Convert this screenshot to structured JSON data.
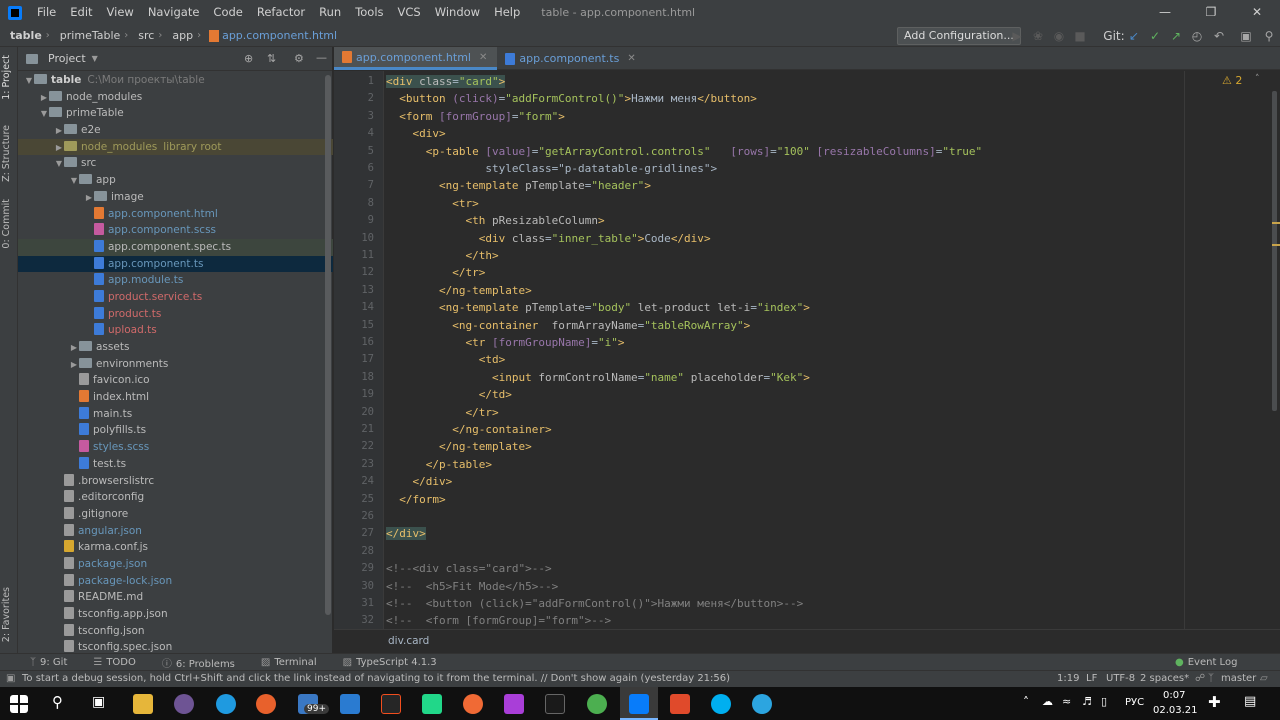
{
  "menu": {
    "items": [
      "File",
      "Edit",
      "View",
      "Navigate",
      "Code",
      "Refactor",
      "Run",
      "Tools",
      "VCS",
      "Window",
      "Help"
    ],
    "title": "table - app.component.html"
  },
  "nav": {
    "crumbs": [
      "table",
      "primeTable",
      "src",
      "app",
      "app.component.html"
    ],
    "add_config": "Add Configuration...",
    "git_label": "Git:"
  },
  "strip": {
    "project": "1: Project",
    "structure": "Z: Structure",
    "commit": "0: Commit",
    "favorites": "2: Favorites"
  },
  "project": {
    "title": "Project",
    "tree": [
      {
        "label": "table",
        "extra": "C:\\Мои проекты\\table",
        "depth": 0,
        "kind": "folder",
        "open": true,
        "color": "bold"
      },
      {
        "label": "node_modules",
        "depth": 1,
        "kind": "folder",
        "open": false,
        "color": "normal"
      },
      {
        "label": "primeTable",
        "depth": 1,
        "kind": "folder",
        "open": true,
        "color": "normal"
      },
      {
        "label": "e2e",
        "depth": 2,
        "kind": "folder",
        "open": false,
        "color": "normal"
      },
      {
        "label": "node_modules",
        "extra": "library root",
        "depth": 2,
        "kind": "folder",
        "open": false,
        "color": "olive",
        "row": "lib"
      },
      {
        "label": "src",
        "depth": 2,
        "kind": "folder",
        "open": true,
        "color": "normal"
      },
      {
        "label": "app",
        "depth": 3,
        "kind": "folder",
        "open": true,
        "color": "normal"
      },
      {
        "label": "image",
        "depth": 4,
        "kind": "folder",
        "open": false,
        "color": "normal"
      },
      {
        "label": "app.component.html",
        "depth": 4,
        "kind": "file",
        "color": "blue",
        "ico": "#e37933"
      },
      {
        "label": "app.component.scss",
        "depth": 4,
        "kind": "file",
        "color": "blue",
        "ico": "#c55a9f"
      },
      {
        "label": "app.component.spec.ts",
        "depth": 4,
        "kind": "file",
        "color": "normal",
        "ico": "#3d7bd8",
        "row": "hl"
      },
      {
        "label": "app.component.ts",
        "depth": 4,
        "kind": "file",
        "color": "blue",
        "ico": "#3d7bd8",
        "row": "sel"
      },
      {
        "label": "app.module.ts",
        "depth": 4,
        "kind": "file",
        "color": "blue",
        "ico": "#3d7bd8"
      },
      {
        "label": "product.service.ts",
        "depth": 4,
        "kind": "file",
        "color": "red",
        "ico": "#3d7bd8"
      },
      {
        "label": "product.ts",
        "depth": 4,
        "kind": "file",
        "color": "red",
        "ico": "#3d7bd8"
      },
      {
        "label": "upload.ts",
        "depth": 4,
        "kind": "file",
        "color": "red",
        "ico": "#3d7bd8"
      },
      {
        "label": "assets",
        "depth": 3,
        "kind": "folder",
        "open": false,
        "color": "normal"
      },
      {
        "label": "environments",
        "depth": 3,
        "kind": "folder",
        "open": false,
        "color": "normal"
      },
      {
        "label": "favicon.ico",
        "depth": 3,
        "kind": "file",
        "color": "normal",
        "ico": "#9a9a9a"
      },
      {
        "label": "index.html",
        "depth": 3,
        "kind": "file",
        "color": "normal",
        "ico": "#e37933"
      },
      {
        "label": "main.ts",
        "depth": 3,
        "kind": "file",
        "color": "normal",
        "ico": "#3d7bd8"
      },
      {
        "label": "polyfills.ts",
        "depth": 3,
        "kind": "file",
        "color": "normal",
        "ico": "#3d7bd8"
      },
      {
        "label": "styles.scss",
        "depth": 3,
        "kind": "file",
        "color": "blue",
        "ico": "#c55a9f"
      },
      {
        "label": "test.ts",
        "depth": 3,
        "kind": "file",
        "color": "normal",
        "ico": "#3d7bd8"
      },
      {
        "label": ".browserslistrc",
        "depth": 2,
        "kind": "file",
        "color": "normal",
        "ico": "#9a9a9a"
      },
      {
        "label": ".editorconfig",
        "depth": 2,
        "kind": "file",
        "color": "normal",
        "ico": "#9a9a9a"
      },
      {
        "label": ".gitignore",
        "depth": 2,
        "kind": "file",
        "color": "normal",
        "ico": "#9a9a9a"
      },
      {
        "label": "angular.json",
        "depth": 2,
        "kind": "file",
        "color": "blue",
        "ico": "#9a9a9a"
      },
      {
        "label": "karma.conf.js",
        "depth": 2,
        "kind": "file",
        "color": "normal",
        "ico": "#d6a72f"
      },
      {
        "label": "package.json",
        "depth": 2,
        "kind": "file",
        "color": "blue",
        "ico": "#9a9a9a"
      },
      {
        "label": "package-lock.json",
        "depth": 2,
        "kind": "file",
        "color": "blue",
        "ico": "#9a9a9a"
      },
      {
        "label": "README.md",
        "depth": 2,
        "kind": "file",
        "color": "normal",
        "ico": "#9a9a9a"
      },
      {
        "label": "tsconfig.app.json",
        "depth": 2,
        "kind": "file",
        "color": "normal",
        "ico": "#9a9a9a"
      },
      {
        "label": "tsconfig.json",
        "depth": 2,
        "kind": "file",
        "color": "normal",
        "ico": "#9a9a9a"
      },
      {
        "label": "tsconfig.spec.json",
        "depth": 2,
        "kind": "file",
        "color": "normal",
        "ico": "#9a9a9a"
      }
    ]
  },
  "tabs": [
    {
      "label": "app.component.html",
      "active": true
    },
    {
      "label": "app.component.ts",
      "active": false
    }
  ],
  "editor": {
    "warnings": "2",
    "crumb": "div.card",
    "lines": [
      "<div class=\"card\">",
      "  <button (click)=\"addFormControl()\">Нажми меня</button>",
      "  <form [formGroup]=\"form\">",
      "    <div>",
      "      <p-table [value]=\"getArrayControl.controls\"   [rows]=\"100\" [resizableColumns]=\"true\"",
      "               styleClass=\"p-datatable-gridlines\">",
      "        <ng-template pTemplate=\"header\">",
      "          <tr>",
      "            <th pResizableColumn>",
      "              <div class=\"inner_table\">Code</div>",
      "            </th>",
      "          </tr>",
      "        </ng-template>",
      "        <ng-template pTemplate=\"body\" let-product let-i=\"index\">",
      "          <ng-container  formArrayName=\"tableRowArray\">",
      "            <tr [formGroupName]=\"i\">",
      "              <td>",
      "                <input formControlName=\"name\" placeholder=\"Kek\">",
      "              </td>",
      "            </tr>",
      "          </ng-container>",
      "        </ng-template>",
      "      </p-table>",
      "    </div>",
      "  </form>",
      "",
      "</div>",
      "",
      "<!--<div class=\"card\">-->",
      "<!--  <h5>Fit Mode</h5>-->",
      "<!--  <button (click)=\"addFormControl()\">Нажми меня</button>-->",
      "<!--  <form [formGroup]=\"form\">-->"
    ]
  },
  "tools": [
    {
      "icon": "git-icon",
      "label": "9: Git"
    },
    {
      "icon": "todo-icon",
      "label": "TODO"
    },
    {
      "icon": "problems-icon",
      "label": "6: Problems"
    },
    {
      "icon": "terminal-icon",
      "label": "Terminal"
    },
    {
      "icon": "typescript-icon",
      "label": "TypeScript 4.1.3"
    }
  ],
  "event_log": "Event Log",
  "status": {
    "message": "To start a debug session, hold Ctrl+Shift and click the link instead of navigating to it from the terminal. // Don't show again (yesterday 21:56)",
    "position": "1:19",
    "line_sep": "LF",
    "encoding": "UTF-8",
    "indent": "2 spaces*",
    "branch": "master"
  },
  "taskbar": {
    "badge": "99+",
    "lang": "РУС",
    "time": "0:07",
    "date": "02.03.21"
  }
}
